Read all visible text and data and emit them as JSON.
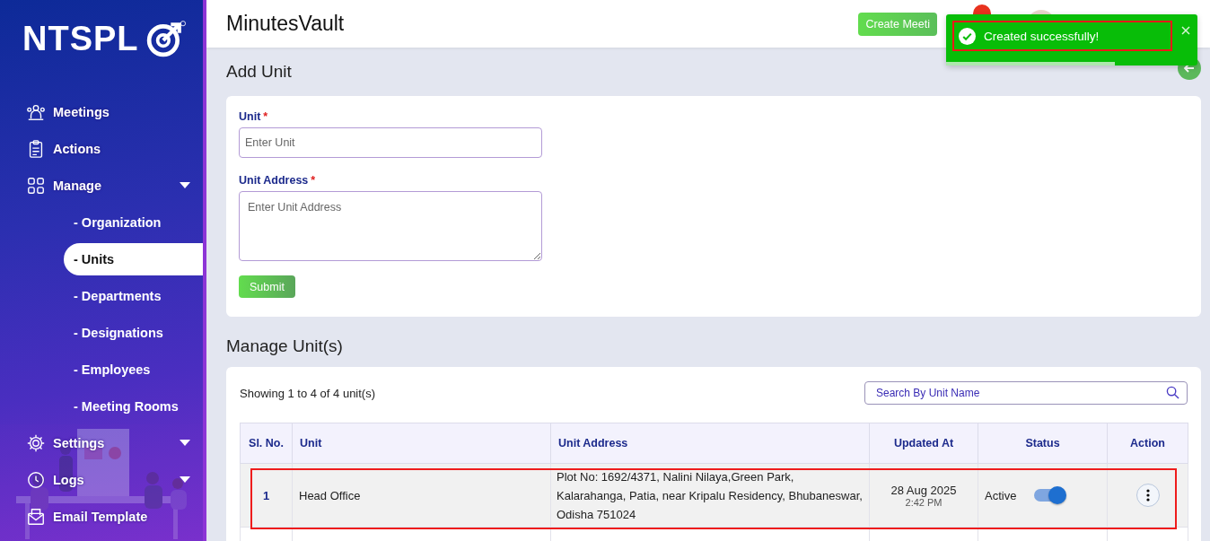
{
  "sidebar": {
    "logo": "NTSPL",
    "items": [
      {
        "label": "Meetings",
        "kind": "link",
        "selected": false
      },
      {
        "label": "Actions",
        "kind": "link",
        "selected": false
      },
      {
        "label": "Manage",
        "kind": "group",
        "selected": false,
        "children": [
          {
            "label": "- Organization",
            "selected": false
          },
          {
            "label": "- Units",
            "selected": true
          },
          {
            "label": "- Departments",
            "selected": false
          },
          {
            "label": "- Designations",
            "selected": false
          },
          {
            "label": "- Employees",
            "selected": false
          },
          {
            "label": "- Meeting Rooms",
            "selected": false
          }
        ]
      },
      {
        "label": "Settings",
        "kind": "group",
        "selected": false
      },
      {
        "label": "Logs",
        "kind": "group",
        "selected": false
      },
      {
        "label": "Email Template",
        "kind": "link",
        "selected": false
      }
    ]
  },
  "header": {
    "title": "MinutesVault",
    "create_button": "Create Meeti"
  },
  "toast": {
    "kind": "success",
    "message": "Created successfully!",
    "level": 0.67
  },
  "add_unit": {
    "title": "Add Unit",
    "fields": [
      {
        "kind": "input",
        "label": "Unit",
        "required_mark": "*",
        "placeholder": "Enter Unit"
      },
      {
        "kind": "textarea",
        "label": "Unit Address",
        "required_mark": "*",
        "placeholder": "Enter Unit Address"
      }
    ],
    "submit": "Submit"
  },
  "manage_units": {
    "title": "Manage Unit(s)",
    "summary": "Showing 1 to 4 of 4 unit(s)",
    "search": {
      "placeholder": "Search By Unit Name"
    },
    "table": {
      "columns": [
        "Sl. No.",
        "Unit",
        "Unit Address",
        "Updated At",
        "Status",
        "Action"
      ],
      "rows": [
        {
          "sl": "1",
          "unit": "Head Office",
          "address": "Plot No: 1692/4371, Nalini Nilaya,Green Park, Kalarahanga, Patia, near Kripalu Residency, Bhubaneswar, Odisha 751024",
          "date": "28 Aug 2025",
          "time": "2:42 PM",
          "status": "Active",
          "on": true,
          "highlighted": true
        }
      ]
    }
  }
}
